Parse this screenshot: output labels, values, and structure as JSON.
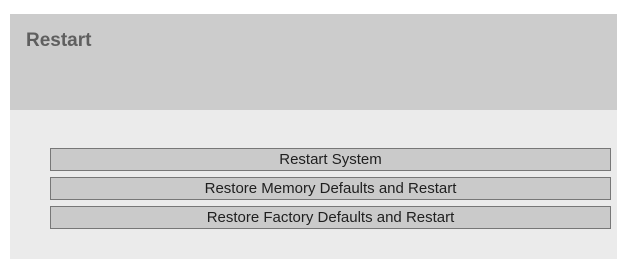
{
  "header": {
    "title": "Restart"
  },
  "actions": {
    "restart_system_label": "Restart System",
    "restore_memory_defaults_label": "Restore Memory Defaults and Restart",
    "restore_factory_defaults_label": "Restore Factory Defaults and Restart"
  },
  "colors": {
    "header_background": "#cccccc",
    "panel_background": "#ebebeb",
    "button_background": "#cacaca",
    "button_border": "#777777",
    "title_text": "#5f5f5f"
  }
}
